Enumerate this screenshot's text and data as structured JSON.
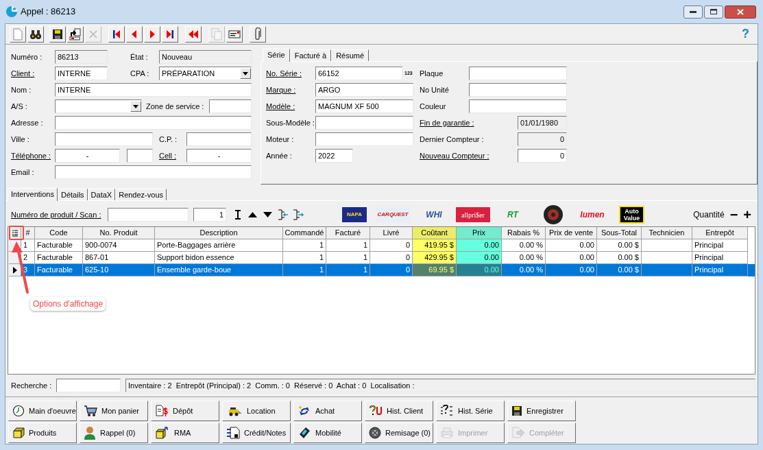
{
  "window": {
    "title": "Appel : 86213"
  },
  "toolbar": {
    "buttons": [
      {
        "disabled": false
      },
      {
        "disabled": false
      },
      {
        "disabled": false
      },
      {
        "disabled": false
      },
      {
        "disabled": true
      },
      {
        "disabled": false
      },
      {
        "disabled": false
      },
      {
        "disabled": false
      },
      {
        "disabled": false
      },
      {
        "disabled": false
      },
      {
        "disabled": true
      },
      {
        "disabled": false
      },
      {
        "disabled": false
      }
    ],
    "help": "?"
  },
  "client_panel": {
    "rows": [
      [
        {
          "label": "Numéro :",
          "link": false,
          "value": "86213",
          "kind": "readonly"
        },
        {
          "label": "État :",
          "link": false,
          "value": "Nouveau",
          "kind": "readonly"
        }
      ],
      [
        {
          "label": "Client :",
          "link": true,
          "value": "INTERNE",
          "kind": "text"
        },
        {
          "label": "CPA :",
          "link": false,
          "value": "PRÉPARATION",
          "kind": "combo"
        }
      ],
      [
        {
          "label": "Nom :",
          "link": false,
          "value": "INTERNE",
          "kind": "text"
        }
      ],
      [
        {
          "label": "A/S :",
          "link": false,
          "kind": "combo"
        },
        {
          "label": "Zone de service :",
          "link": false,
          "kind": "text"
        }
      ],
      [
        {
          "label": "Adresse :",
          "link": false,
          "kind": "text"
        }
      ],
      [
        {
          "label": "Ville :",
          "link": false,
          "kind": "text"
        },
        {
          "label": "C.P. :",
          "link": false,
          "kind": "text"
        }
      ],
      [
        {
          "label": "Téléphone :",
          "link": true,
          "value": "-",
          "kind": "text"
        },
        {
          "kind": "text"
        },
        {
          "label": "Cell :",
          "link": true,
          "value": "-",
          "kind": "text"
        }
      ],
      [
        {
          "label": "Email :",
          "link": false,
          "kind": "text"
        }
      ]
    ]
  },
  "vehicle_panel": {
    "tabs": [
      {
        "label": "Série",
        "selected": true
      },
      {
        "label": "Facturé à",
        "selected": false
      },
      {
        "label": "Résumé",
        "selected": false
      }
    ],
    "rows": [
      {
        "left": {
          "label": "No. Série :",
          "link": true,
          "value": "66152",
          "kind": "text",
          "badge": "123"
        },
        "right": {
          "label": "Plaque",
          "link": false,
          "kind": "text"
        }
      },
      {
        "left": {
          "label": "Marque :",
          "link": true,
          "value": "ARGO",
          "kind": "text"
        },
        "right": {
          "label": "No Unité",
          "link": false,
          "kind": "text"
        }
      },
      {
        "left": {
          "label": "Modèle :",
          "link": true,
          "value": "MAGNUM XF 500",
          "kind": "text"
        },
        "right": {
          "label": "Couleur",
          "link": false,
          "kind": "text"
        }
      },
      {
        "left": {
          "label": "Sous-Modèle :",
          "link": false,
          "kind": "text"
        },
        "right": {
          "label": "Fin de garantie :",
          "link": true,
          "value": "01/01/1980",
          "kind": "readonly"
        }
      },
      {
        "left": {
          "label": "Moteur :",
          "link": false,
          "kind": "text"
        },
        "right": {
          "label": "Dernier Compteur :",
          "link": false,
          "value": "0",
          "kind": "readonly"
        }
      },
      {
        "left": {
          "label": "Année :",
          "link": false,
          "value": "2022",
          "kind": "text"
        },
        "right": {
          "label": "Nouveau Compteur :",
          "link": true,
          "value": "0",
          "kind": "text"
        }
      }
    ]
  },
  "lines_panel": {
    "tabs": [
      {
        "label": "Interventions",
        "selected": true
      },
      {
        "label": "Détails",
        "selected": false
      },
      {
        "label": "DataX",
        "selected": false
      },
      {
        "label": "Rendez-vous",
        "selected": false
      }
    ],
    "scan": {
      "label": "Numéro de produit / Scan :",
      "quantity": "1"
    },
    "suppliers": [
      {
        "kind": "text",
        "label": "NAPA"
      },
      {
        "kind": "text",
        "label": "CARQUEST"
      },
      {
        "kind": "text",
        "label": "WHI"
      },
      {
        "kind": "text",
        "label": "allpri$er"
      },
      {
        "kind": "text",
        "label": "RT"
      },
      {
        "kind": "emblem"
      },
      {
        "kind": "text",
        "label": "lumen"
      },
      {
        "kind": "text",
        "label": "Auto Value"
      }
    ],
    "quantity": {
      "label": "Quantité",
      "minus": "−",
      "plus": "+"
    }
  },
  "table": {
    "columns": [
      {
        "label": "#"
      },
      {
        "label": "Code"
      },
      {
        "label": "No. Produit"
      },
      {
        "label": "Description"
      },
      {
        "label": "Commandé"
      },
      {
        "label": "Facturé"
      },
      {
        "label": "Livré"
      },
      {
        "label": "Coûtant",
        "color": "#ffff66"
      },
      {
        "label": "Prix",
        "color": "#66ffe0"
      },
      {
        "label": "Rabais %"
      },
      {
        "label": "Prix de vente"
      },
      {
        "label": "Sous-Total"
      },
      {
        "label": "Technicien"
      },
      {
        "label": "Entrepôt"
      }
    ],
    "rows": [
      {
        "number": "1",
        "code": "Facturable",
        "product_no": "900-0074",
        "description": "Porte-Baggages arrière",
        "ordered": "1",
        "invoiced": "1",
        "delivered": "0",
        "cost": "419.95 $",
        "price": "0.00",
        "discount": "0.00 %",
        "sale_price": "0.00",
        "subtotal": "0.00 $",
        "warehouse": "Principal",
        "selected": false
      },
      {
        "number": "2",
        "code": "Facturable",
        "product_no": "867-01",
        "description": "Support bidon essence",
        "ordered": "1",
        "invoiced": "1",
        "delivered": "0",
        "cost": "429.95 $",
        "price": "0.00",
        "discount": "0.00 %",
        "sale_price": "0.00",
        "subtotal": "0.00 $",
        "warehouse": "Principal",
        "selected": false
      },
      {
        "number": "3",
        "code": "Facturable",
        "product_no": "625-10",
        "description": "Ensemble garde-boue",
        "ordered": "1",
        "invoiced": "1",
        "delivered": "0",
        "cost": "69.95 $",
        "price": "0.00",
        "discount": "0.00 %",
        "sale_price": "0.00",
        "subtotal": "0.00 $",
        "warehouse": "Principal",
        "selected": true
      }
    ]
  },
  "annotation": {
    "label": "Options d'affichage"
  },
  "search": {
    "label": "Recherche :"
  },
  "status_bar": "Inventaire : 2  Entrepôt (Principal) : 2  Comm. : 0  Réservé : 0  Achat : 0  Localisation :",
  "actions": [
    [
      {
        "label": "Main d'oeuvre",
        "disabled": false
      },
      {
        "label": "Mon panier",
        "disabled": false
      },
      {
        "label": "Dépôt",
        "disabled": false
      },
      {
        "label": "Location",
        "disabled": false
      },
      {
        "label": "Achat",
        "disabled": false
      },
      {
        "label": "Hist. Client",
        "disabled": false
      },
      {
        "label": "Hist. Série",
        "disabled": false
      },
      {
        "label": "Enregistrer",
        "disabled": false
      }
    ],
    [
      {
        "label": "Produits",
        "disabled": false
      },
      {
        "label": "Rappel (0)",
        "disabled": false
      },
      {
        "label": "RMA",
        "disabled": false
      },
      {
        "label": "Crédit/Notes",
        "disabled": false
      },
      {
        "label": "Mobilité",
        "disabled": false
      },
      {
        "label": "Remisage (0)",
        "disabled": false
      },
      {
        "label": "Imprimer",
        "disabled": true
      },
      {
        "label": "Compléter",
        "disabled": true
      }
    ]
  ]
}
